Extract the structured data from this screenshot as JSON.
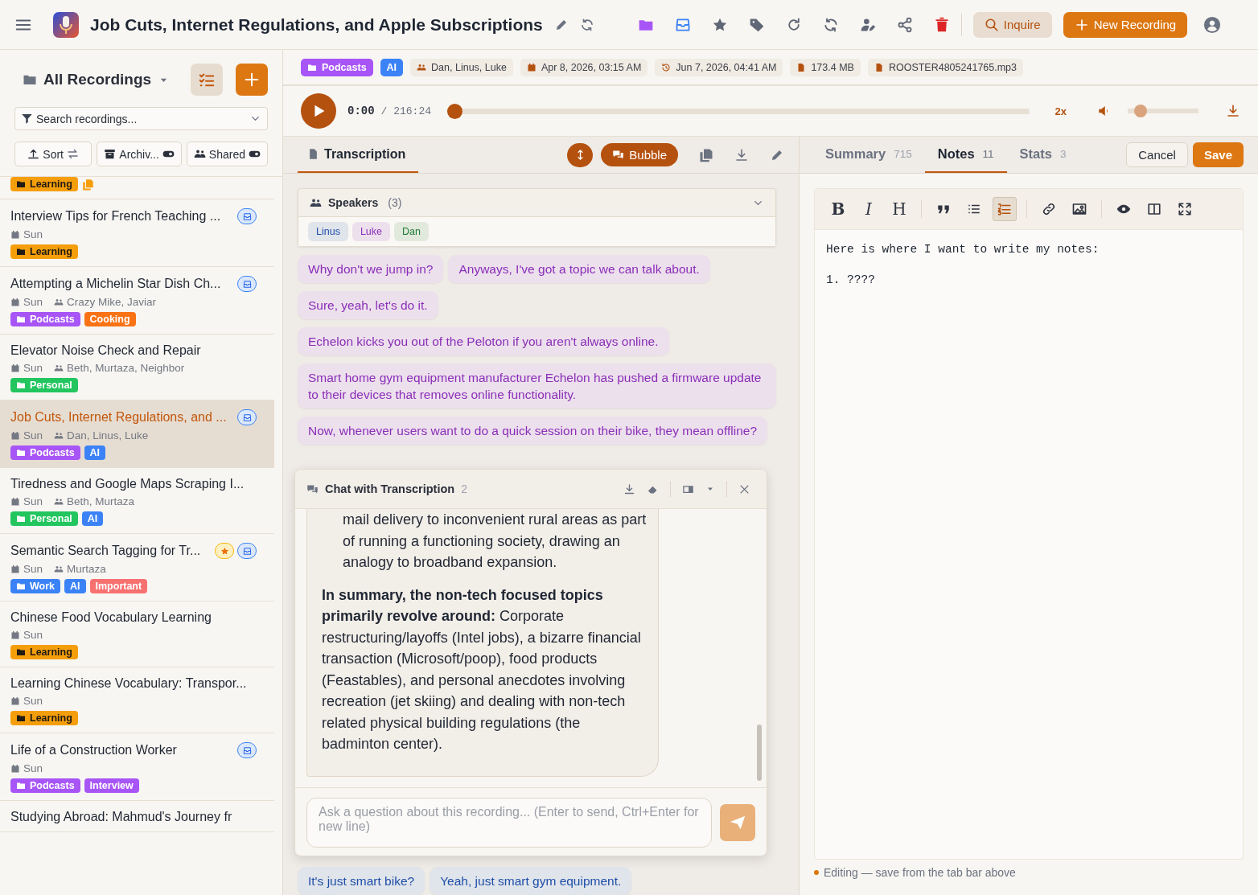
{
  "header": {
    "title": "Job Cuts, Internet Regulations, and Apple Subscriptions",
    "inquire_button": "Inquire",
    "new_recording_button": "New Recording"
  },
  "sidebar": {
    "title": "All Recordings",
    "search": {
      "placeholder": "Search recordings..."
    },
    "filters": [
      {
        "kind": "sort",
        "label": "Sort"
      },
      {
        "kind": "archived",
        "label": "Archiv...",
        "on": false
      },
      {
        "kind": "shared",
        "label": "Shared",
        "on": false
      }
    ],
    "recordings": [
      {
        "tags": [
          {
            "label": "Learning",
            "color": "#f59e0b",
            "kind": "folder"
          }
        ],
        "duplicate": true,
        "starred": false,
        "inbox": false,
        "selected": false
      },
      {
        "title": "Interview Tips for French Teaching ...",
        "date": "Sun",
        "tags": [
          {
            "label": "Learning",
            "color": "#f59e0b",
            "kind": "folder"
          }
        ],
        "duplicate": false,
        "starred": false,
        "inbox": true,
        "selected": false
      },
      {
        "title": "Attempting a Michelin Star Dish Ch...",
        "date": "Sun",
        "speakers": "Crazy Mike, Javiar",
        "tags": [
          {
            "label": "Podcasts",
            "color": "#a855f7",
            "kind": "folder"
          },
          {
            "label": "Cooking",
            "color": "#f97316",
            "kind": "plain"
          }
        ],
        "duplicate": false,
        "starred": false,
        "inbox": true,
        "selected": false
      },
      {
        "title": "Elevator Noise Check and Repair",
        "date": "Sun",
        "speakers": "Beth, Murtaza, Neighbor",
        "tags": [
          {
            "label": "Personal",
            "color": "#22c55e",
            "kind": "folder"
          }
        ],
        "duplicate": false,
        "starred": false,
        "inbox": false,
        "selected": false
      },
      {
        "title": "Job Cuts, Internet Regulations, and ...",
        "date": "Sun",
        "speakers": "Dan, Linus, Luke",
        "tags": [
          {
            "label": "Podcasts",
            "color": "#a855f7",
            "kind": "folder"
          },
          {
            "label": "AI",
            "color": "#3b82f6",
            "kind": "plain"
          }
        ],
        "duplicate": false,
        "starred": false,
        "inbox": true,
        "selected": true
      },
      {
        "title": "Tiredness and Google Maps Scraping I...",
        "date": "Sun",
        "speakers": "Beth, Murtaza",
        "tags": [
          {
            "label": "Personal",
            "color": "#22c55e",
            "kind": "folder"
          },
          {
            "label": "AI",
            "color": "#3b82f6",
            "kind": "plain"
          }
        ],
        "duplicate": false,
        "starred": false,
        "inbox": false,
        "selected": false
      },
      {
        "title": "Semantic Search Tagging for Tr...",
        "date": "Sun",
        "speakers": "Murtaza",
        "tags": [
          {
            "label": "Work",
            "color": "#3b82f6",
            "kind": "folder"
          },
          {
            "label": "AI",
            "color": "#3b82f6",
            "kind": "plain"
          },
          {
            "label": "Important",
            "color": "#f87171",
            "kind": "plain"
          }
        ],
        "duplicate": false,
        "starred": true,
        "inbox": true,
        "selected": false
      },
      {
        "title": "Chinese Food Vocabulary Learning",
        "date": "Sun",
        "tags": [
          {
            "label": "Learning",
            "color": "#f59e0b",
            "kind": "folder"
          }
        ],
        "duplicate": false,
        "starred": false,
        "inbox": false,
        "selected": false
      },
      {
        "title": "Learning Chinese Vocabulary: Transpor...",
        "date": "Sun",
        "tags": [
          {
            "label": "Learning",
            "color": "#f59e0b",
            "kind": "folder"
          }
        ],
        "duplicate": false,
        "starred": false,
        "inbox": false,
        "selected": false
      },
      {
        "title": "Life of a Construction Worker",
        "date": "Sun",
        "tags": [
          {
            "label": "Podcasts",
            "color": "#a855f7",
            "kind": "folder"
          },
          {
            "label": "Interview",
            "color": "#a855f7",
            "kind": "plain"
          }
        ],
        "duplicate": false,
        "starred": false,
        "inbox": true,
        "selected": false
      },
      {
        "title": "Studying Abroad: Mahmud's Journey fr",
        "duplicate": false,
        "starred": false,
        "inbox": false,
        "selected": false
      }
    ]
  },
  "meta": [
    {
      "kind": "folder-tag",
      "label": "Podcasts",
      "color": "#a855f7"
    },
    {
      "kind": "tag",
      "label": "AI",
      "color": "#3b82f6"
    },
    {
      "kind": "speakers",
      "label": "Dan, Linus, Luke"
    },
    {
      "kind": "created",
      "label": "Apr 8, 2026, 03:15 AM"
    },
    {
      "kind": "modified",
      "label": "Jun 7, 2026, 04:41 AM"
    },
    {
      "kind": "size",
      "label": "173.4 MB"
    },
    {
      "kind": "file",
      "label": "ROOSTER4805241765.mp3"
    }
  ],
  "player": {
    "current": "0:00",
    "total": "/ 216:24",
    "level": 0,
    "speed": "2x",
    "volume": {
      "level": 0.23
    }
  },
  "transcription": {
    "tab": "Transcription",
    "view_button": "Bubble",
    "speakers_panel": {
      "title": "Speakers",
      "count": "(3)",
      "expanded": true,
      "speakers": [
        {
          "name": "Linus",
          "color": "#1e4fa8"
        },
        {
          "name": "Luke",
          "color": "#8a2fb8"
        },
        {
          "name": "Dan",
          "color": "#1f7a33"
        }
      ]
    },
    "segments_above": [
      {
        "text": "Why don't we jump in?",
        "color": "#8a2fb8"
      },
      {
        "text": "Anyways, I've got a topic we can talk about.",
        "color": "#8a2fb8"
      },
      {
        "text": "Sure, yeah, let's do it.",
        "color": "#8a2fb8"
      },
      {
        "text": "Echelon kicks you out of the Peloton if you aren't always online.",
        "color": "#8a2fb8"
      },
      {
        "text": "Smart home gym equipment manufacturer Echelon has pushed a firmware update to their devices that removes online functionality.",
        "color": "#8a2fb8"
      },
      {
        "text": "Now, whenever users want to do a quick session on their bike, they mean offline?",
        "color": "#8a2fb8"
      }
    ],
    "segments_below": [
      {
        "text": "It's just smart bike?",
        "color": "#1e4fa8"
      },
      {
        "text": "Yeah, just smart gym equipment.",
        "color": "#1e4fa8"
      }
    ]
  },
  "chat": {
    "title": "Chat with Transcription",
    "count": "2",
    "message": {
      "list_item": "mail delivery to inconvenient rural areas as part of running a functioning society, drawing an analogy to broadband expansion.",
      "summary": "**In summary, the non-tech focused topics primarily revolve around:** Corporate restructuring/layoffs (Intel jobs), a bizarre financial transaction (Microsoft/poop), food products (Feastables), and personal anecdotes involving recreation (jet skiing) and dealing with non-tech related physical building regulations (the badminton center)."
    },
    "input": {
      "placeholder": "Ask a question about this recording... (Enter to send, Ctrl+Enter for new line)"
    }
  },
  "notes_panel": {
    "tabs": [
      {
        "label": "Summary",
        "count": "715",
        "selected": false
      },
      {
        "label": "Notes",
        "count": "11",
        "selected": true
      },
      {
        "label": "Stats",
        "count": "3",
        "selected": false
      }
    ],
    "cancel_button": "Cancel",
    "save_button": "Save",
    "toolbar": [
      {
        "kind": "bold",
        "label": "B",
        "selected": false
      },
      {
        "kind": "italic",
        "label": "I",
        "selected": false
      },
      {
        "kind": "heading",
        "label": "H",
        "selected": false
      },
      {
        "kind": "quote",
        "selected": false
      },
      {
        "kind": "list",
        "selected": false
      },
      {
        "kind": "numbered-list",
        "selected": true
      },
      {
        "kind": "link",
        "selected": false
      },
      {
        "kind": "image",
        "selected": false
      },
      {
        "kind": "eye",
        "selected": false
      },
      {
        "kind": "columns",
        "selected": false
      },
      {
        "kind": "expand",
        "selected": false
      }
    ],
    "content": [
      "Here is where I want to write my notes:",
      "1. ????"
    ],
    "status": "Editing — save from the tab bar above"
  }
}
